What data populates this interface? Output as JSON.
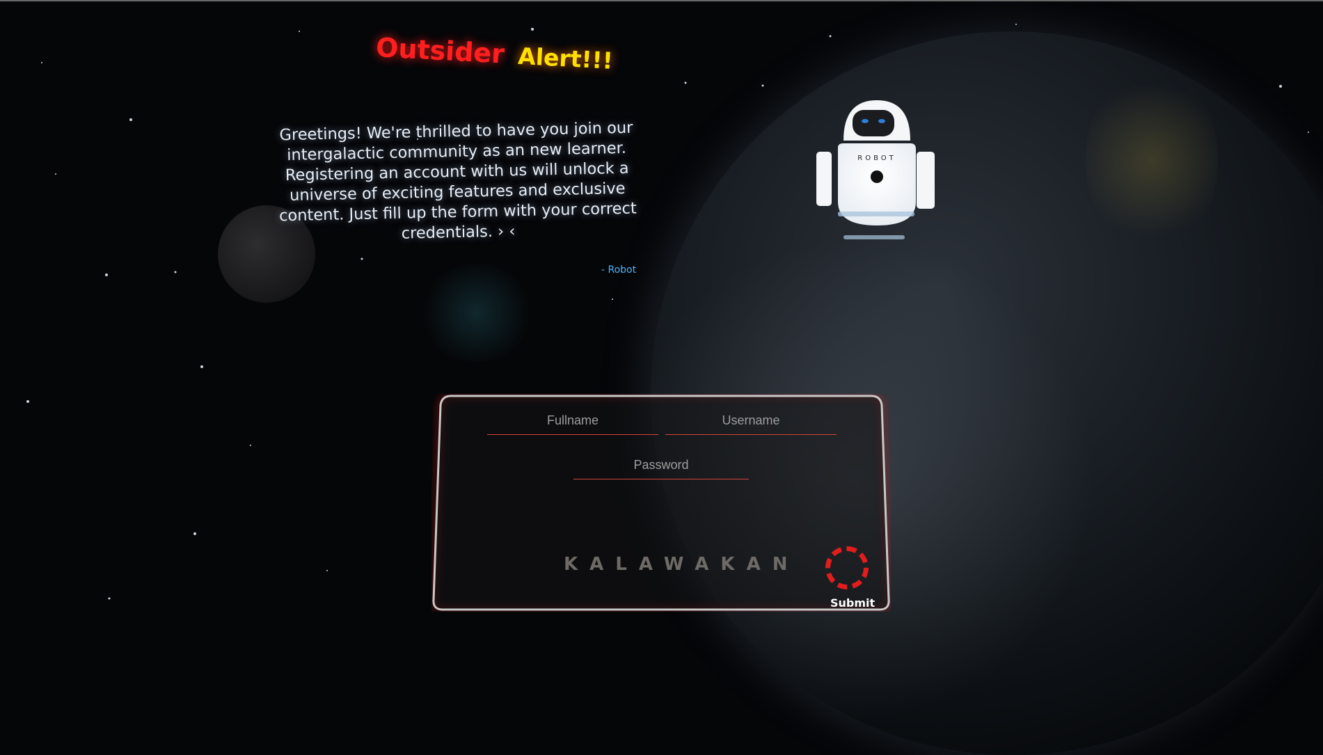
{
  "header": {
    "title_word1": "Outsider",
    "title_word2": "Alert!!!"
  },
  "message": {
    "text": "Greetings! We're thrilled to have you join our intergalactic community as an new learner. Registering an account with us will unlock a universe of exciting features and exclusive content. Just fill up the form with your correct credentials. › ‹",
    "signature": "- Robot"
  },
  "robot": {
    "chest_label": "ROBOT",
    "icon": "robot-icon"
  },
  "form": {
    "fullname_placeholder": "Fullname",
    "username_placeholder": "Username",
    "password_placeholder": "Password",
    "brand": "KALAWAKAN",
    "submit_label": "Submit"
  },
  "colors": {
    "background": "#050608",
    "title_red": "#ff1f1f",
    "title_yellow": "#ffe100",
    "signature_blue": "#4fb3ff",
    "field_underline": "#d2443b",
    "submit_ring": "#e11d1d",
    "card_border": "#c9c9c9"
  }
}
